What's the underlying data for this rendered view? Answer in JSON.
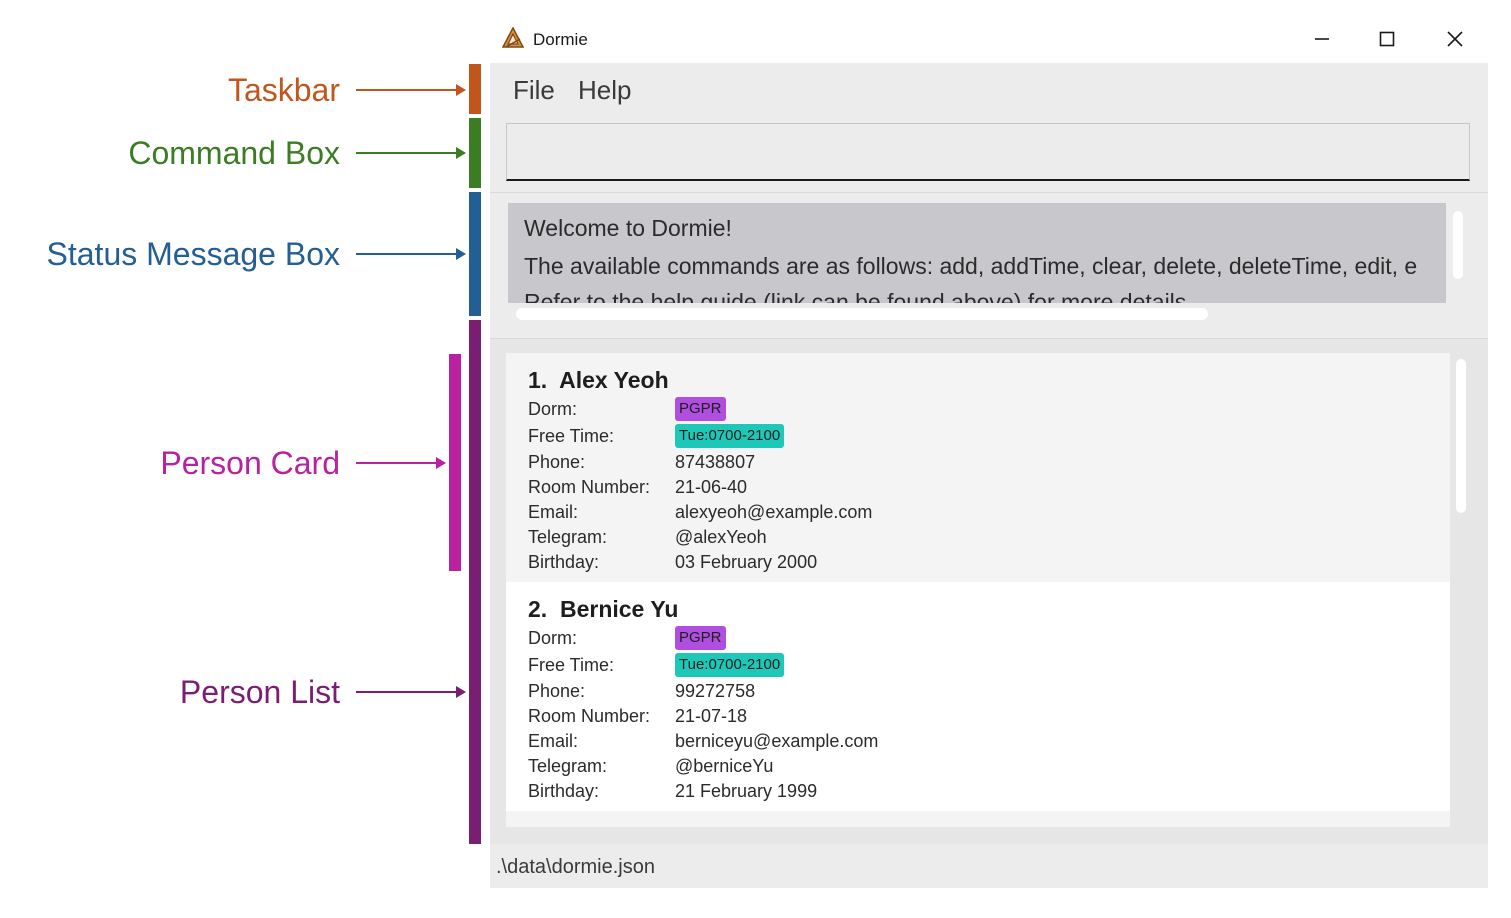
{
  "annotations": [
    {
      "label": "Taskbar",
      "color": "#c0561c"
    },
    {
      "label": "Command Box",
      "color": "#3a7d22"
    },
    {
      "label": "Status Message Box",
      "color": "#235e95"
    },
    {
      "label": "Person Card",
      "color": "#b8229e"
    },
    {
      "label": "Person List",
      "color": "#7a1e72"
    }
  ],
  "window": {
    "title": "Dormie",
    "minimize_icon": "minimize-icon",
    "maximize_icon": "maximize-icon",
    "close_icon": "close-icon"
  },
  "menu": {
    "items": [
      "File",
      "Help"
    ]
  },
  "command_box": {
    "value": "",
    "placeholder": ""
  },
  "status": {
    "lines": [
      "Welcome to Dormie!",
      "The available commands are as follows: add, addTime, clear, delete, deleteTime, edit, e",
      "Refer to the help guide (link can be found above) for more details."
    ]
  },
  "field_labels": {
    "dorm": "Dorm:",
    "free_time": "Free Time:",
    "phone": "Phone:",
    "room": "Room Number:",
    "email": "Email:",
    "telegram": "Telegram:",
    "birthday": "Birthday:"
  },
  "persons": [
    {
      "index": "1.",
      "name": "Alex Yeoh",
      "dorm_tag": "PGPR",
      "free_time_tag": "Tue:0700-2100",
      "phone": "87438807",
      "room": "21-06-40",
      "email": "alexyeoh@example.com",
      "telegram": "@alexYeoh",
      "birthday": "03 February 2000"
    },
    {
      "index": "2.",
      "name": "Bernice Yu",
      "dorm_tag": "PGPR",
      "free_time_tag": "Tue:0700-2100",
      "phone": "99272758",
      "room": "21-07-18",
      "email": "berniceyu@example.com",
      "telegram": "@berniceYu",
      "birthday": "21 February 1999"
    }
  ],
  "footer": {
    "path": ".\\data\\dormie.json"
  },
  "colors": {
    "dorm_tag": "#b04ee0",
    "time_tag": "#1ec8b8",
    "status_bg": "#c8c8cc"
  }
}
